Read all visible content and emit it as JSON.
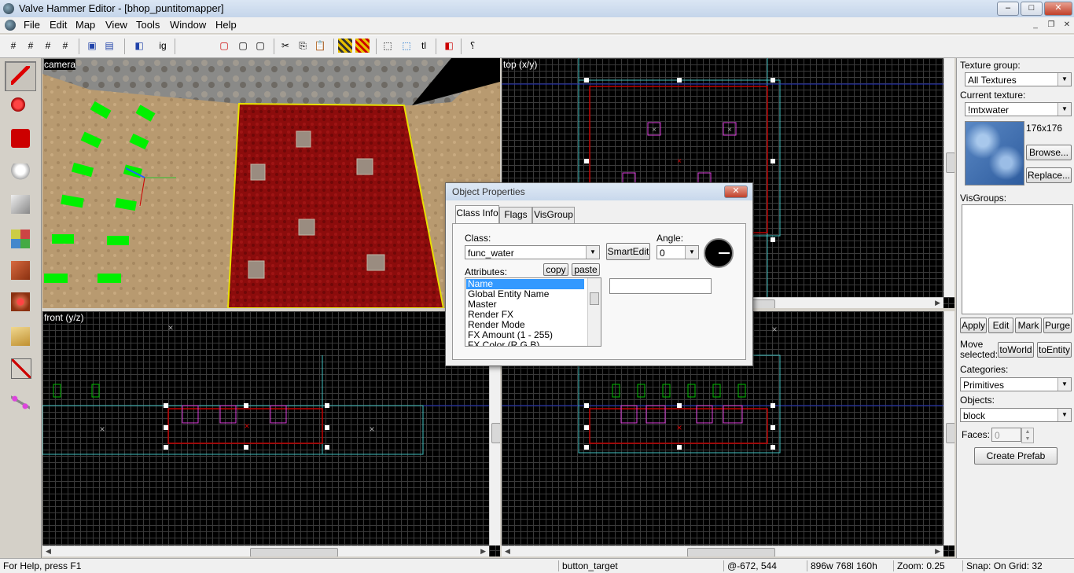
{
  "window": {
    "title": "Valve Hammer Editor - [bhop_puntitomapper]",
    "min": "–",
    "max": "□",
    "close": "✕"
  },
  "menu": [
    "File",
    "Edit",
    "Map",
    "View",
    "Tools",
    "Window",
    "Help"
  ],
  "toolbar_icons": [
    "grid-icon",
    "grid-toggle-icon",
    "grid-smaller-icon",
    "grid-larger-icon",
    "group-icon",
    "ungroup-icon",
    "carve-icon",
    "hide-icon",
    "unhide-icon",
    "cordon-icon",
    "cut-icon",
    "copy-icon",
    "paste-icon",
    "texture-lock-icon",
    "texture-scale-lock-icon",
    "selection-box-icon",
    "select-icon",
    "transform-icon",
    "run-map-icon",
    "help-icon"
  ],
  "left_tools": [
    "selection-tool",
    "magnify-tool",
    "camera-tool",
    "entity-tool",
    "block-tool",
    "texture-application-tool",
    "apply-current-texture-tool",
    "decal-tool",
    "overlay-tool",
    "clipping-tool",
    "vertex-tool",
    "path-tool"
  ],
  "viewports": {
    "camera": "camera",
    "top": "top (x/y)",
    "front": "front (y/z)",
    "side": ""
  },
  "dialog": {
    "title": "Object Properties",
    "tabs": [
      "Class Info",
      "Flags",
      "VisGroup"
    ],
    "class_label": "Class:",
    "class_value": "func_water",
    "smartedit": "SmartEdit",
    "angle_label": "Angle:",
    "angle_value": "0",
    "attributes_label": "Attributes:",
    "copy": "copy",
    "paste": "paste",
    "attributes": [
      "Name",
      "Global Entity Name",
      "Master",
      "Render FX",
      "Render Mode",
      "FX Amount (1 - 255)",
      "FX Color (R G B)"
    ],
    "value_field": ""
  },
  "right_panel": {
    "texture_group_label": "Texture group:",
    "texture_group": "All Textures",
    "current_texture_label": "Current texture:",
    "current_texture": "!mtxwater",
    "texture_size": "176x176",
    "browse": "Browse...",
    "replace": "Replace...",
    "visgroups_label": "VisGroups:",
    "apply": "Apply",
    "edit": "Edit",
    "mark": "Mark",
    "purge": "Purge",
    "move_selected": "Move selected:",
    "to_world": "toWorld",
    "to_entity": "toEntity",
    "categories_label": "Categories:",
    "categories": "Primitives",
    "objects_label": "Objects:",
    "objects": "block",
    "faces_label": "Faces:",
    "faces": "0",
    "create_prefab": "Create Prefab"
  },
  "status": {
    "help": "For Help, press F1",
    "selection": "button_target",
    "coords": "@-672, 544",
    "size": "896w 768l 160h",
    "zoom": "Zoom: 0.25",
    "snap": "Snap: On Grid: 32"
  },
  "colors": {
    "brush_red": "#c00000",
    "selection_white": "#ffffff",
    "entity_green": "#00c000",
    "entity_magenta": "#e040e0",
    "water_red": "#8a0a0a",
    "cyan_bounds": "#40c0c0"
  }
}
